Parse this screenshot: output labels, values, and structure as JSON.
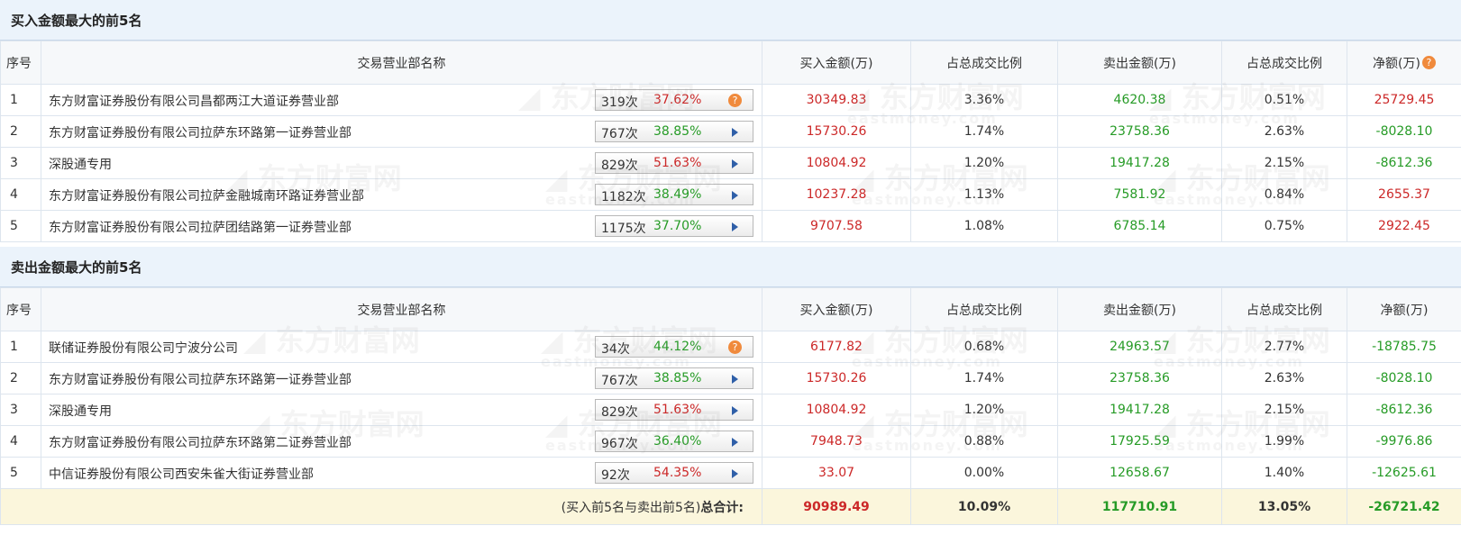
{
  "colors": {
    "header_bg": "#ebf3fb",
    "up": "#cc2828",
    "down": "#269b26",
    "total_bg": "#fbf6dc",
    "help_dot": "#f08a3c",
    "arrow": "#2f5fa8"
  },
  "watermark": {
    "cn": "东方财富网",
    "en": "eastmoney.com"
  },
  "buy_section": {
    "title": "买入金额最大的前5名",
    "headers": {
      "seq": "序号",
      "name": "交易营业部名称",
      "buy": "买入金额(万)",
      "buy_ratio": "占总成交比例",
      "sell": "卖出金额(万)",
      "sell_ratio": "占总成交比例",
      "net": "净额(万)"
    },
    "rows": [
      {
        "seq": "1",
        "name": "东方财富证券股份有限公司昌都两江大道证券营业部",
        "count": "319次",
        "rate": "37.62%",
        "rate_dir": "up",
        "pill_icon": "help-icon",
        "buy": "30349.83",
        "buy_ratio": "3.36%",
        "sell": "4620.38",
        "sell_ratio": "0.51%",
        "net": "25729.45",
        "net_dir": "up"
      },
      {
        "seq": "2",
        "name": "东方财富证券股份有限公司拉萨东环路第一证券营业部",
        "count": "767次",
        "rate": "38.85%",
        "rate_dir": "down",
        "pill_icon": "arrow-right-icon",
        "buy": "15730.26",
        "buy_ratio": "1.74%",
        "sell": "23758.36",
        "sell_ratio": "2.63%",
        "net": "-8028.10",
        "net_dir": "down"
      },
      {
        "seq": "3",
        "name": "深股通专用",
        "count": "829次",
        "rate": "51.63%",
        "rate_dir": "up",
        "pill_icon": "arrow-right-icon",
        "buy": "10804.92",
        "buy_ratio": "1.20%",
        "sell": "19417.28",
        "sell_ratio": "2.15%",
        "net": "-8612.36",
        "net_dir": "down"
      },
      {
        "seq": "4",
        "name": "东方财富证券股份有限公司拉萨金融城南环路证券营业部",
        "count": "1182次",
        "rate": "38.49%",
        "rate_dir": "down",
        "pill_icon": "arrow-right-icon",
        "buy": "10237.28",
        "buy_ratio": "1.13%",
        "sell": "7581.92",
        "sell_ratio": "0.84%",
        "net": "2655.37",
        "net_dir": "up"
      },
      {
        "seq": "5",
        "name": "东方财富证券股份有限公司拉萨团结路第一证券营业部",
        "count": "1175次",
        "rate": "37.70%",
        "rate_dir": "down",
        "pill_icon": "arrow-right-icon",
        "buy": "9707.58",
        "buy_ratio": "1.08%",
        "sell": "6785.14",
        "sell_ratio": "0.75%",
        "net": "2922.45",
        "net_dir": "up"
      }
    ]
  },
  "sell_section": {
    "title": "卖出金额最大的前5名",
    "headers": {
      "seq": "序号",
      "name": "交易营业部名称",
      "buy": "买入金额(万)",
      "buy_ratio": "占总成交比例",
      "sell": "卖出金额(万)",
      "sell_ratio": "占总成交比例",
      "net": "净额(万)"
    },
    "rows": [
      {
        "seq": "1",
        "name": "联储证券股份有限公司宁波分公司",
        "count": "34次",
        "rate": "44.12%",
        "rate_dir": "down",
        "pill_icon": "help-icon",
        "buy": "6177.82",
        "buy_ratio": "0.68%",
        "sell": "24963.57",
        "sell_ratio": "2.77%",
        "net": "-18785.75",
        "net_dir": "down"
      },
      {
        "seq": "2",
        "name": "东方财富证券股份有限公司拉萨东环路第一证券营业部",
        "count": "767次",
        "rate": "38.85%",
        "rate_dir": "down",
        "pill_icon": "arrow-right-icon",
        "buy": "15730.26",
        "buy_ratio": "1.74%",
        "sell": "23758.36",
        "sell_ratio": "2.63%",
        "net": "-8028.10",
        "net_dir": "down"
      },
      {
        "seq": "3",
        "name": "深股通专用",
        "count": "829次",
        "rate": "51.63%",
        "rate_dir": "up",
        "pill_icon": "arrow-right-icon",
        "buy": "10804.92",
        "buy_ratio": "1.20%",
        "sell": "19417.28",
        "sell_ratio": "2.15%",
        "net": "-8612.36",
        "net_dir": "down"
      },
      {
        "seq": "4",
        "name": "东方财富证券股份有限公司拉萨东环路第二证券营业部",
        "count": "967次",
        "rate": "36.40%",
        "rate_dir": "down",
        "pill_icon": "arrow-right-icon",
        "buy": "7948.73",
        "buy_ratio": "0.88%",
        "sell": "17925.59",
        "sell_ratio": "1.99%",
        "net": "-9976.86",
        "net_dir": "down"
      },
      {
        "seq": "5",
        "name": "中信证券股份有限公司西安朱雀大街证券营业部",
        "count": "92次",
        "rate": "54.35%",
        "rate_dir": "up",
        "pill_icon": "arrow-right-icon",
        "buy": "33.07",
        "buy_ratio": "0.00%",
        "sell": "12658.67",
        "sell_ratio": "1.40%",
        "net": "-12625.61",
        "net_dir": "down"
      }
    ],
    "total": {
      "label_prefix": "(买入前5名与卖出前5名)",
      "label_bold": "总合计:",
      "buy": "90989.49",
      "buy_ratio": "10.09%",
      "sell": "117710.91",
      "sell_ratio": "13.05%",
      "net": "-26721.42"
    }
  }
}
